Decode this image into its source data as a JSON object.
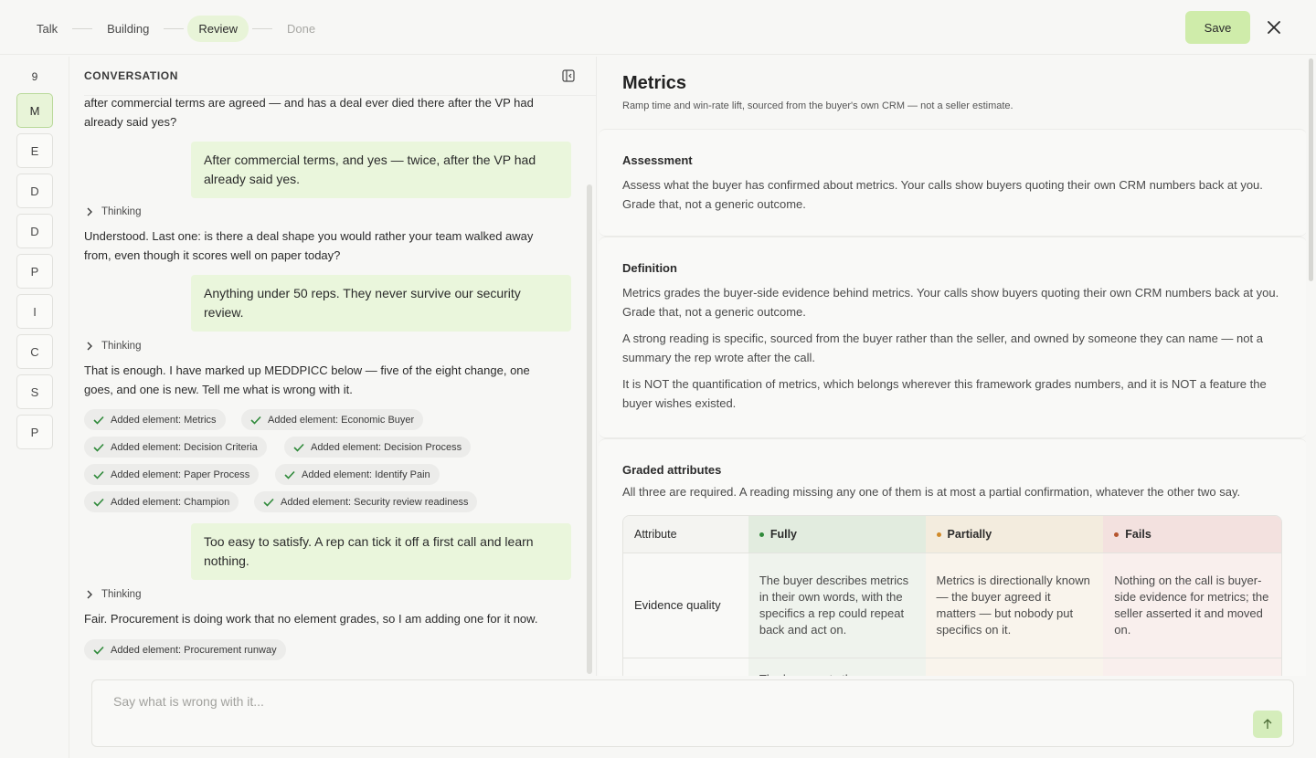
{
  "steps": [
    {
      "label": "Talk"
    },
    {
      "label": "Building"
    },
    {
      "label": "Review"
    },
    {
      "label": "Done"
    }
  ],
  "actions": {
    "save": "Save",
    "close_icon": "close-icon"
  },
  "rail": {
    "count": "9",
    "items": [
      "M",
      "E",
      "D",
      "D",
      "P",
      "I",
      "C",
      "S",
      "P"
    ]
  },
  "conversation": {
    "title": "CONVERSATION",
    "messages": [
      {
        "type": "ai",
        "text": "after commercial terms are agreed — and has a deal ever died there after the VP had already said yes?"
      },
      {
        "type": "user",
        "text": "After commercial terms, and yes — twice, after the VP had already said yes."
      },
      {
        "type": "thinking",
        "text": "Thinking"
      },
      {
        "type": "ai",
        "text": "Understood. Last one: is there a deal shape you would rather your team walked away from, even though it scores well on paper today?"
      },
      {
        "type": "user",
        "text": "Anything under 50 reps. They never survive our security review."
      },
      {
        "type": "thinking",
        "text": "Thinking"
      },
      {
        "type": "ai",
        "text": "That is enough. I have marked up MEDDPICC below — five of the eight change, one goes, and one is new. Tell me what is wrong with it."
      },
      {
        "type": "user",
        "text": "Too easy to satisfy. A rep can tick it off a first call and learn nothing."
      },
      {
        "type": "thinking",
        "text": "Thinking"
      },
      {
        "type": "ai",
        "text": "Fair. Procurement is doing work that no element grades, so I am adding one for it now."
      }
    ],
    "chips": [
      "Added element: Metrics",
      "Added element: Economic Buyer",
      "Added element: Decision Criteria",
      "Added element: Decision Process",
      "Added element: Paper Process",
      "Added element: Identify Pain",
      "Added element: Champion",
      "Added element: Security review readiness",
      "Added element: Procurement runway"
    ]
  },
  "composer": {
    "placeholder": "Say what is wrong with it..."
  },
  "detail": {
    "title": "Metrics",
    "subtitle": "Ramp time and win-rate lift, sourced from the buyer's own CRM — not a seller estimate.",
    "assessment": {
      "heading": "Assessment",
      "text": "Assess what the buyer has confirmed about metrics. Your calls show buyers quoting their own CRM numbers back at you. Grade that, not a generic outcome."
    },
    "definition": {
      "heading": "Definition",
      "paragraphs": [
        "Metrics grades the buyer-side evidence behind metrics. Your calls show buyers quoting their own CRM numbers back at you. Grade that, not a generic outcome.",
        "A strong reading is specific, sourced from the buyer rather than the seller, and owned by someone they can name — not a summary the rep wrote after the call.",
        "It is NOT the quantification of metrics, which belongs wherever this framework grades numbers, and it is NOT a feature the buyer wishes existed."
      ]
    },
    "graded": {
      "heading": "Graded attributes",
      "intro": "All three are required. A reading missing any one of them is at most a partial confirmation, whatever the other two say.",
      "columns": {
        "attribute": "Attribute",
        "fully": "Fully",
        "partially": "Partially",
        "fails": "Fails"
      },
      "colors": {
        "fully": "#2f8a3a",
        "partially": "#d08a2a",
        "fails": "#b5552e"
      },
      "rows": [
        {
          "attribute": "Evidence quality",
          "fully": "The buyer describes metrics in their own words, with the specifics a rep could repeat back and act on.",
          "partially": "Metrics is directionally known — the buyer agreed it matters — but nobody put specifics on it.",
          "fails": "Nothing on the call is buyer-side evidence for metrics; the seller asserted it and moved on."
        },
        {
          "attribute": "",
          "fully": "The buyer puts the",
          "partially": "",
          "fails": ""
        }
      ]
    }
  }
}
